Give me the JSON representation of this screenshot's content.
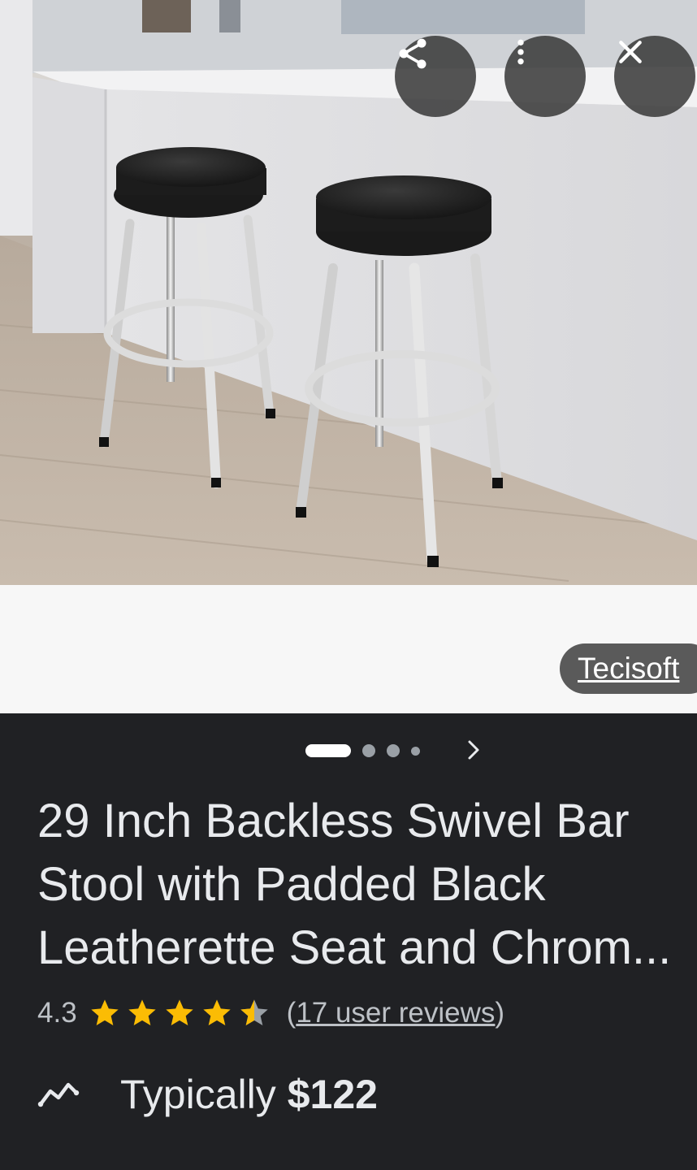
{
  "image": {
    "source": "Tecisoft",
    "icons": {
      "share": "share-icon",
      "more": "more-vert-icon",
      "close": "close-icon"
    }
  },
  "carousel": {
    "total": 4,
    "active": 1,
    "next_icon": "chevron-right-icon"
  },
  "product": {
    "title_lines": [
      "29 Inch Backless Swivel Bar",
      "Stool with Padded Black",
      "Leatherette Seat and Chrom..."
    ],
    "rating": "4.3",
    "rating_value": 4.3,
    "reviews_open": "(",
    "reviews_link": "17 user reviews",
    "reviews_close": ")",
    "price_label": "Typically",
    "price": "$122",
    "price_icon": "trending-icon"
  },
  "colors": {
    "panel_bg": "#202124",
    "star": "#fbbc04",
    "text": "#e8eaed",
    "muted": "#bdc1c6"
  }
}
